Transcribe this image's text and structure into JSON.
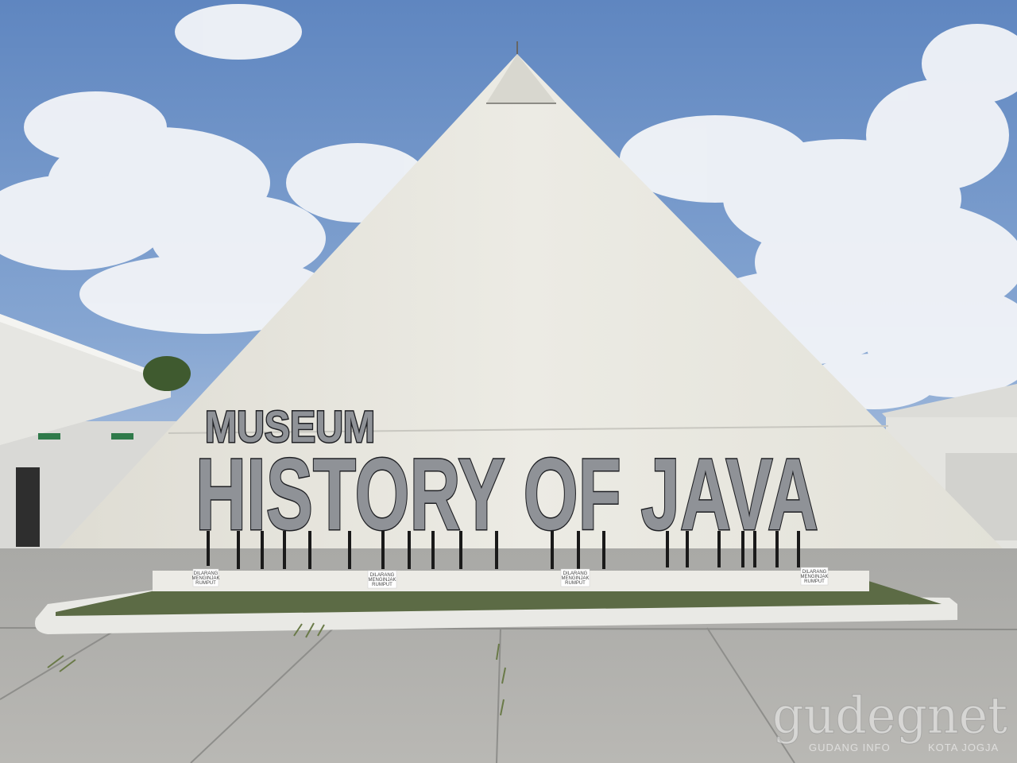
{
  "sign": {
    "line1": "MUSEUM",
    "line2": "HISTORY OF JAVA"
  },
  "plaques": [
    {
      "title": "DILARANG",
      "line1": "MENGINJAK",
      "line2": "RUMPUT"
    },
    {
      "title": "DILARANG",
      "line1": "MENGINJAK",
      "line2": "RUMPUT"
    },
    {
      "title": "DILARANG",
      "line1": "MENGINJAK",
      "line2": "RUMPUT"
    },
    {
      "title": "DILARANG",
      "line1": "MENGINJAK",
      "line2": "RUMPUT"
    }
  ],
  "watermark": {
    "main": "gudegnet",
    "sub_left": "GUDANG INFO",
    "sub_right": "KOTA JOGJA"
  },
  "colors": {
    "sky": "#6b8fc4",
    "pyramid": "#e9e8e0",
    "letters": "#8f9297",
    "letter_outline": "#1f2024",
    "pavement": "#b3b3b0",
    "grass": "#5c6b45"
  }
}
